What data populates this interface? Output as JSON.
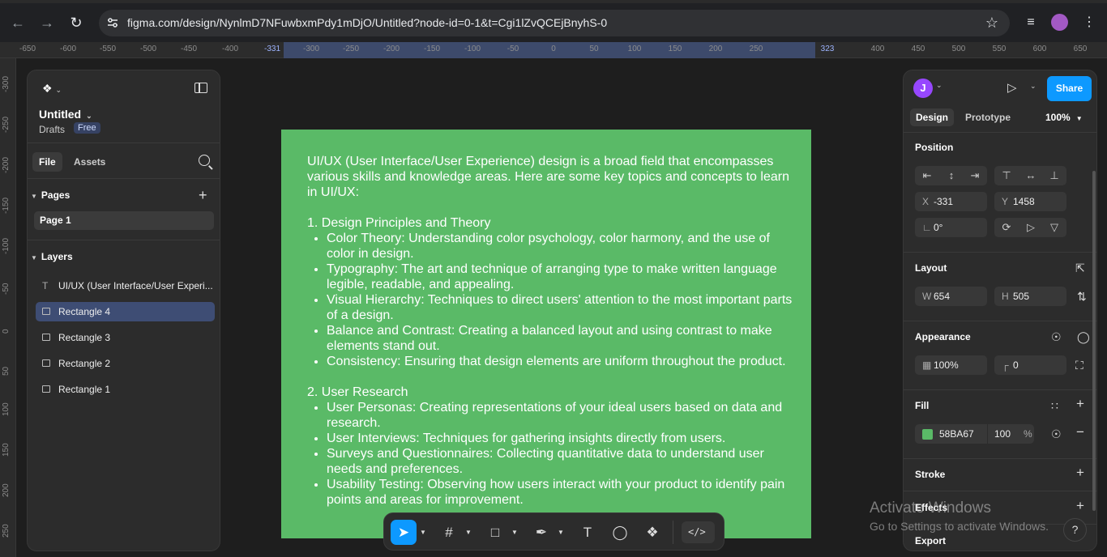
{
  "browser": {
    "url": "figma.com/design/NynlmD7NFuwbxmPdy1mDjO/Untitled?node-id=0-1&t=Cgi1lZvQCEjBnyhS-0",
    "back_icon": "arrow-left-icon",
    "forward_icon": "arrow-right-icon",
    "reload_icon": "reload-icon"
  },
  "rulers": {
    "top": [
      "-650",
      "-600",
      "-550",
      "-500",
      "-450",
      "-400",
      "-331",
      "-300",
      "-250",
      "-200",
      "-150",
      "-100",
      "-50",
      "0",
      "50",
      "100",
      "150",
      "200",
      "250",
      "323",
      "400",
      "450",
      "500",
      "550",
      "600",
      "650"
    ],
    "left": [
      "-300",
      "-250",
      "-200",
      "-150",
      "-100",
      "-50",
      "0",
      "50",
      "100",
      "150",
      "200",
      "250"
    ]
  },
  "left_panel": {
    "file_name": "Untitled",
    "location": "Drafts",
    "plan_badge": "Free",
    "tabs": [
      "File",
      "Assets"
    ],
    "pages_heading": "Pages",
    "pages": [
      "Page 1"
    ],
    "layers_heading": "Layers",
    "layers": [
      {
        "name": "UI/UX (User Interface/User Experi...",
        "type": "text",
        "selected": false
      },
      {
        "name": "Rectangle 4",
        "type": "rect",
        "selected": true
      },
      {
        "name": "Rectangle 3",
        "type": "rect",
        "selected": false
      },
      {
        "name": "Rectangle 2",
        "type": "rect",
        "selected": false
      },
      {
        "name": "Rectangle 1",
        "type": "rect",
        "selected": false
      }
    ]
  },
  "canvas": {
    "frame_color": "#5ABA67",
    "intro": "UI/UX (User Interface/User Experience) design is a broad field that encompasses various skills and knowledge areas. Here are some key topics and concepts to learn in UI/UX:",
    "section1_title": "1. Design Principles and Theory",
    "section1_items": [
      "Color Theory: Understanding color psychology, color harmony, and the use of color in design.",
      "Typography: The art and technique of arranging type to make written language legible, readable, and appealing.",
      "Visual Hierarchy: Techniques to direct users' attention to the most important parts of a design.",
      "Balance and Contrast: Creating a balanced layout and using contrast to make elements stand out.",
      "Consistency: Ensuring that design elements are uniform throughout the product."
    ],
    "section2_title": "2. User Research",
    "section2_items": [
      "User Personas: Creating representations of your ideal users based on data and research.",
      "User Interviews: Techniques for gathering insights directly from users.",
      "Surveys and Questionnaires: Collecting quantitative data to understand user needs and preferences.",
      "Usability Testing: Observing how users interact with your product to identify pain points and areas for improvement."
    ]
  },
  "toolbar": {
    "dev_mode_label": "</>"
  },
  "right_panel": {
    "avatar_initial": "J",
    "share_label": "Share",
    "tabs": [
      "Design",
      "Prototype"
    ],
    "zoom": "100%",
    "position_heading": "Position",
    "x_label": "X",
    "x_value": "-331",
    "y_label": "Y",
    "y_value": "1458",
    "rotation_value": "0°",
    "layout_heading": "Layout",
    "w_label": "W",
    "w_value": "654",
    "h_label": "H",
    "h_value": "505",
    "appearance_heading": "Appearance",
    "opacity_value": "100%",
    "radius_value": "0",
    "fill_heading": "Fill",
    "fill_hex": "58BA67",
    "fill_opacity": "100",
    "fill_percent": "%",
    "stroke_heading": "Stroke",
    "effects_heading": "Effects",
    "export_heading": "Export"
  },
  "watermark": {
    "line1": "Activate Windows",
    "line2": "Go to Settings to activate Windows."
  }
}
